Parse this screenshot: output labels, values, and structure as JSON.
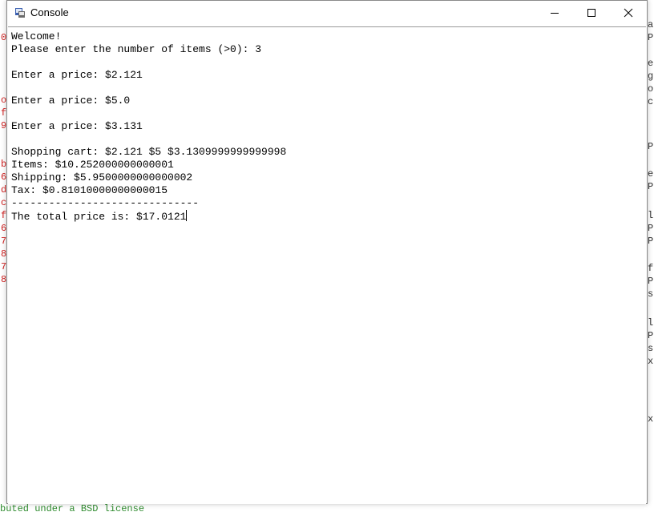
{
  "window": {
    "title": "Console"
  },
  "controls": {
    "minimize_icon": "minimize-icon",
    "maximize_icon": "maximize-icon",
    "close_icon": "close-icon"
  },
  "console": {
    "lines": [
      "Welcome!",
      "Please enter the number of items (>0): 3",
      "",
      "Enter a price: $2.121",
      "",
      "Enter a price: $5.0",
      "",
      "Enter a price: $3.131",
      "",
      "Shopping cart: $2.121 $5 $3.1309999999999998",
      "Items: $10.252000000000001",
      "Shipping: $5.9500000000000002",
      "Tax: $0.81010000000000015",
      "------------------------------",
      "The total price is: $17.0121"
    ]
  },
  "background": {
    "left_glyphs": [
      "0",
      "o",
      "f",
      "9",
      "b",
      "6",
      "d",
      "c",
      "f",
      "6",
      "7",
      "8",
      "7",
      "8"
    ],
    "right_glyphs": [
      "a",
      "P",
      "e",
      "g",
      "o",
      "c",
      "P",
      "e",
      "P",
      "l",
      "P",
      "P",
      "f",
      "P",
      "s",
      "l",
      "P",
      "s",
      "x",
      "x"
    ],
    "bottom_text": "buted under a BSD license"
  },
  "colors": {
    "bg_left_text": "#d02020",
    "bg_right_text": "#303030",
    "bg_bottom_text": "#2e8b2e"
  }
}
